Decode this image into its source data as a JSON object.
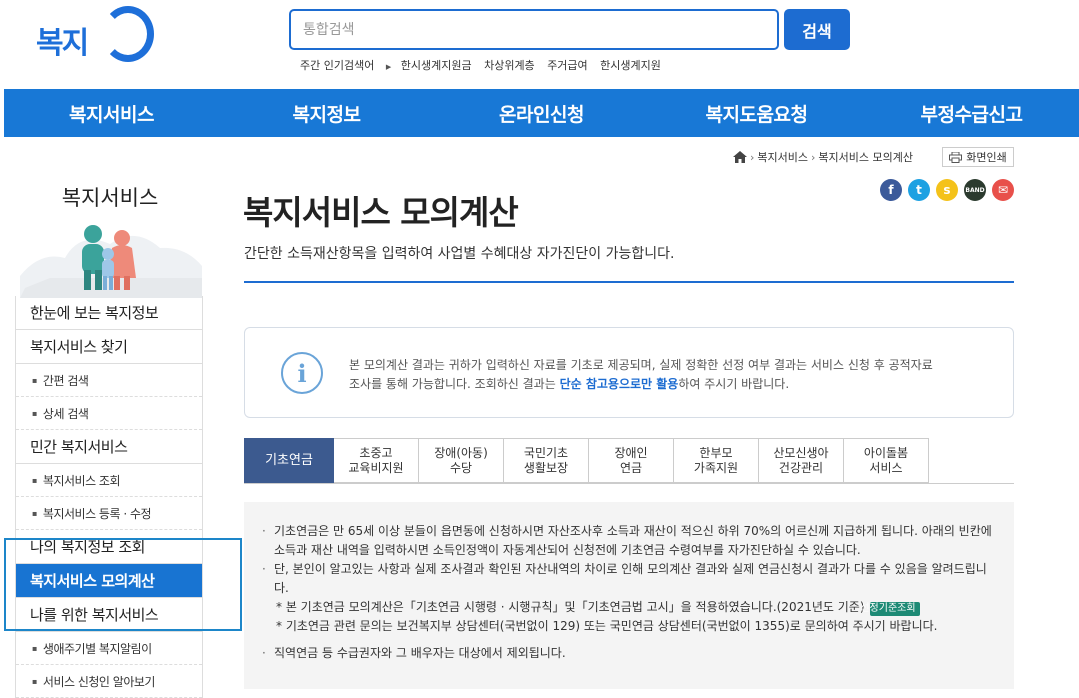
{
  "header": {
    "logo_text": "복지",
    "search_placeholder": "통합검색",
    "search_button": "검색",
    "popular_label": "주간 인기검색어",
    "popular_keywords": [
      "한시생계지원금",
      "차상위계층",
      "주거급여",
      "한시생계지원"
    ]
  },
  "gnb": [
    "복지서비스",
    "복지정보",
    "온라인신청",
    "복지도움요청",
    "부정수급신고"
  ],
  "sidebar": {
    "title": "복지서비스",
    "menu": [
      {
        "label": "한눈에 보는 복지정보",
        "type": "main"
      },
      {
        "label": "복지서비스 찾기",
        "type": "main"
      },
      {
        "label": "간편 검색",
        "type": "sub"
      },
      {
        "label": "상세 검색",
        "type": "sub"
      },
      {
        "label": "민간 복지서비스",
        "type": "main"
      },
      {
        "label": "복지서비스 조회",
        "type": "sub"
      },
      {
        "label": "복지서비스 등록 · 수정",
        "type": "sub"
      },
      {
        "label": "나의 복지정보 조회",
        "type": "main"
      },
      {
        "label": "복지서비스 모의계산",
        "type": "active"
      },
      {
        "label": "나를 위한 복지서비스",
        "type": "main"
      },
      {
        "label": "생애주기별 복지알림이",
        "type": "sub"
      },
      {
        "label": "서비스 신청인 알아보기",
        "type": "sub"
      }
    ]
  },
  "breadcrumb": [
    "복지서비스",
    "복지서비스 모의계산"
  ],
  "print_label": "화면인쇄",
  "share_icons": [
    "facebook-icon",
    "twitter-icon",
    "kakaostory-icon",
    "band-icon",
    "email-icon"
  ],
  "colors": {
    "primary": "#1d6cd1",
    "nav": "#1878d6",
    "tab_active": "#3c5a8f",
    "badge": "#1e8a75"
  },
  "page": {
    "title": "복지서비스 모의계산",
    "description": "간단한 소득재산항목을 입력하여 사업별 수혜대상 자가진단이 가능합니다."
  },
  "notice": {
    "line1": "본 모의계산 결과는 귀하가 입력하신 자료를 기초로 제공되며, 실제 정확한 선정 여부 결과는 서비스 신청 후 공적자료",
    "line2_prefix": "조사를 통해 가능합니다. 조회하신 결과는 ",
    "line2_bold": "단순 참고용으로만 활용",
    "line2_suffix": "하여 주시기 바랍니다."
  },
  "tabs": [
    "기초연금",
    "초중고\n교육비지원",
    "장애(아동)\n수당",
    "국민기초\n생활보장",
    "장애인\n연금",
    "한부모\n가족지원",
    "산모신생아\n건강관리",
    "아이돌봄\n서비스"
  ],
  "info": {
    "p1": "기초연금은 만 65세 이상 분들이 읍면동에 신청하시면 자산조사후 소득과 재산이 적으신 하위 70%의 어르신께 지급하게 됩니다. 아래의 빈칸에 소득과 재산 내역을 입력하시면 소득인정액이 자동계산되어 신청전에 기초연금 수령여부를 자가진단하실 수 있습니다.",
    "p2": "단, 본인이 알고있는 사항과 실제 조사결과 확인된 자산내역의 차이로 인해 모의계산 결과와 실제 연금신청시 결과가 다를 수 있음을 알려드립니다.",
    "n1": "* 본 기초연금 모의계산은「기초연금 시행령 · 시행규칙」및「기초연금법 고시」을 적용하였습니다.(2021년도 기준)",
    "n1_badge": "선정기준조회",
    "n2": "* 기초연금 관련 문의는 보건복지부 상담센터(국번없이 129) 또는 국민연금 상담센터(국번없이 1355)로 문의하여 주시기 바랍니다.",
    "p3": "직역연금 등 수급권자와 그 배우자는 대상에서 제외됩니다."
  }
}
